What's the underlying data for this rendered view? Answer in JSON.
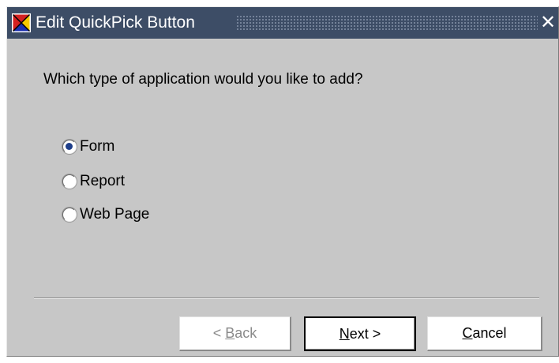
{
  "window": {
    "title": "Edit QuickPick Button",
    "close_symbol": "✕",
    "app_icon": "app-logo-icon",
    "close_icon": "close-icon"
  },
  "content": {
    "prompt": "Which type of application would you like to add?",
    "options": [
      {
        "label": "Form",
        "selected": true
      },
      {
        "label": "Report",
        "selected": false
      },
      {
        "label": "Web Page",
        "selected": false
      }
    ]
  },
  "buttons": {
    "back": {
      "prefix": "< ",
      "mnemonic": "B",
      "rest": "ack",
      "enabled": false
    },
    "next": {
      "prefix": "",
      "mnemonic": "N",
      "rest": "ext >",
      "enabled": true
    },
    "cancel": {
      "prefix": "",
      "mnemonic": "C",
      "rest": "ancel",
      "enabled": true
    }
  },
  "colors": {
    "titlebar": "#3d4d66",
    "dialog_background": "#c7c7c7",
    "radio_dot": "#1f3f8a"
  }
}
